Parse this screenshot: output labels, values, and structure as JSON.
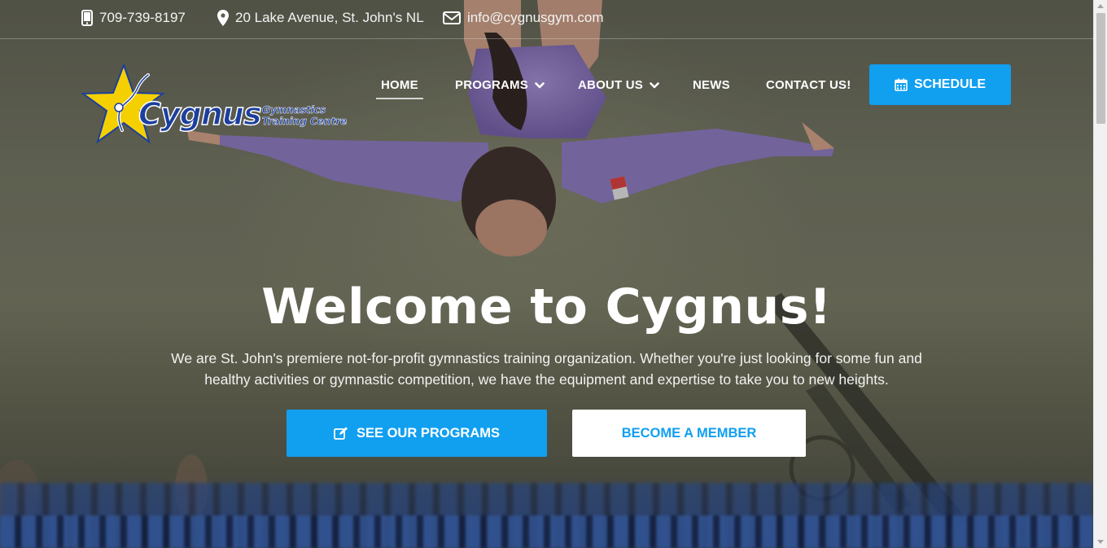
{
  "topbar": {
    "phone": "709-739-8197",
    "address": "20 Lake Avenue, St. John's NL",
    "email": "info@cygnusgym.com"
  },
  "logo": {
    "name": "Cygnus",
    "tagline_line1": "Gymnastics",
    "tagline_line2": "Training Centre"
  },
  "nav": {
    "items": [
      {
        "label": "HOME",
        "active": true,
        "has_dropdown": false
      },
      {
        "label": "PROGRAMS",
        "active": false,
        "has_dropdown": true
      },
      {
        "label": "ABOUT US",
        "active": false,
        "has_dropdown": true
      },
      {
        "label": "NEWS",
        "active": false,
        "has_dropdown": false
      },
      {
        "label": "CONTACT US!",
        "active": false,
        "has_dropdown": false
      }
    ],
    "schedule_label": "SCHEDULE"
  },
  "hero": {
    "title": "Welcome to Cygnus!",
    "description_line1": "We are St. John's premiere not-for-profit gymnastics training organization. Whether you're just looking for some fun and",
    "description_line2": "healthy activities or gymnastic competition, we have the equipment and expertise to take you to new heights.",
    "primary_button": "SEE OUR PROGRAMS",
    "secondary_button": "BECOME A MEMBER"
  },
  "colors": {
    "accent": "#119ff0",
    "logo_star": "#f5d000",
    "logo_text": "#1c3f9e"
  },
  "icons": {
    "phone": "mobile-phone-icon",
    "address": "map-pin-icon",
    "email": "envelope-icon",
    "schedule": "calendar-icon",
    "programs": "edit-icon",
    "dropdown": "chevron-down-icon"
  }
}
